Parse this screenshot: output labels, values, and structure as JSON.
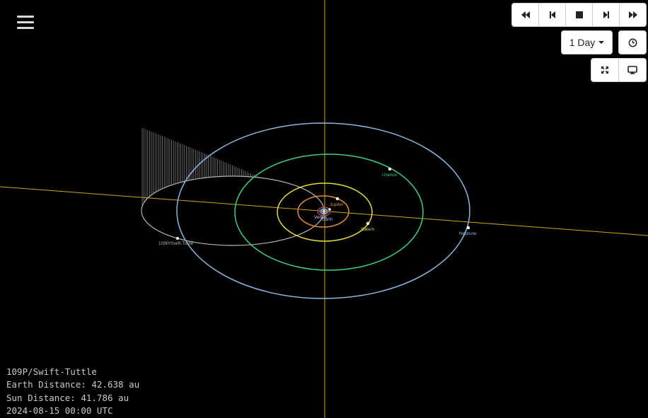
{
  "menu": {
    "icon": "hamburger-menu-icon"
  },
  "playback": {
    "buttons": [
      {
        "icon": "fast-backward-icon"
      },
      {
        "icon": "step-backward-icon"
      },
      {
        "icon": "stop-icon"
      },
      {
        "icon": "step-forward-icon"
      },
      {
        "icon": "fast-forward-icon"
      }
    ]
  },
  "time_step": {
    "selected": "1 Day"
  },
  "view_controls": {
    "clock_icon": "clock-icon",
    "fullscreen_icon": "fullscreen-icon",
    "monitor_icon": "monitor-icon"
  },
  "scene": {
    "ecliptic_color": "#d4b21c",
    "planets": [
      {
        "name": "Venus",
        "color": "#cfcfff"
      },
      {
        "name": "Earth",
        "color": "#8fb0ff"
      },
      {
        "name": "Jupiter",
        "color": "#e0893a"
      },
      {
        "name": "Saturn",
        "color": "#e2dc3a"
      },
      {
        "name": "Uranus",
        "color": "#3ccf7c"
      },
      {
        "name": "Neptune",
        "color": "#8ab8e0"
      }
    ],
    "comet": {
      "name": "109P/Swift-Tuttle",
      "color": "#b0b0b0"
    }
  },
  "info": {
    "object": "109P/Swift-Tuttle",
    "earth_distance": "Earth Distance: 42.638 au",
    "sun_distance": "Sun Distance: 41.786 au",
    "datetime": "2024-08-15 00:00 UTC"
  }
}
